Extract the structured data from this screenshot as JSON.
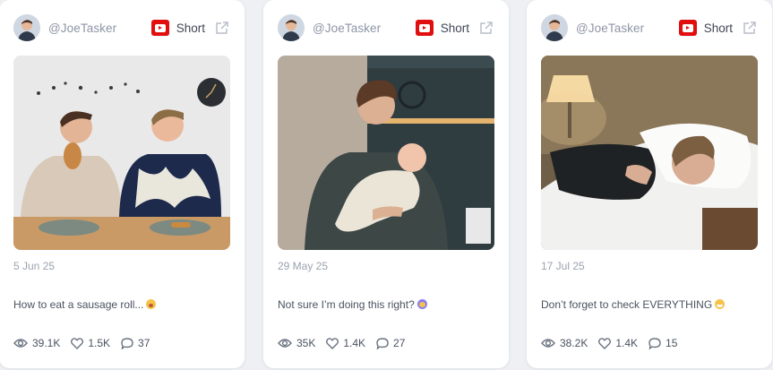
{
  "cards": [
    {
      "handle": "@JoeTasker",
      "platform_icon": "youtube-icon",
      "type_label": "Short",
      "date": "5 Jun 25",
      "caption": "How to eat a sausage roll...",
      "caption_emoji": "yawning-face-emoji",
      "views": "39.1K",
      "likes": "1.5K",
      "comments": "37"
    },
    {
      "handle": "@JoeTasker",
      "platform_icon": "youtube-icon",
      "type_label": "Short",
      "date": "29 May 25",
      "caption": "Not sure I’m doing this right?",
      "caption_emoji": "crying-face-emoji",
      "views": "35K",
      "likes": "1.4K",
      "comments": "27"
    },
    {
      "handle": "@JoeTasker",
      "platform_icon": "youtube-icon",
      "type_label": "Short",
      "date": "17 Jul 25",
      "caption": "Don’t forget to check EVERYTHING",
      "caption_emoji": "grinning-face-emoji",
      "views": "38.2K",
      "likes": "1.4K",
      "comments": "15"
    }
  ],
  "colors": {
    "youtube_red": "#e00e0e",
    "muted_text": "#8d96a6",
    "body_text": "#4a5260",
    "card_background": "#ffffff",
    "page_background": "#eef0f3"
  }
}
